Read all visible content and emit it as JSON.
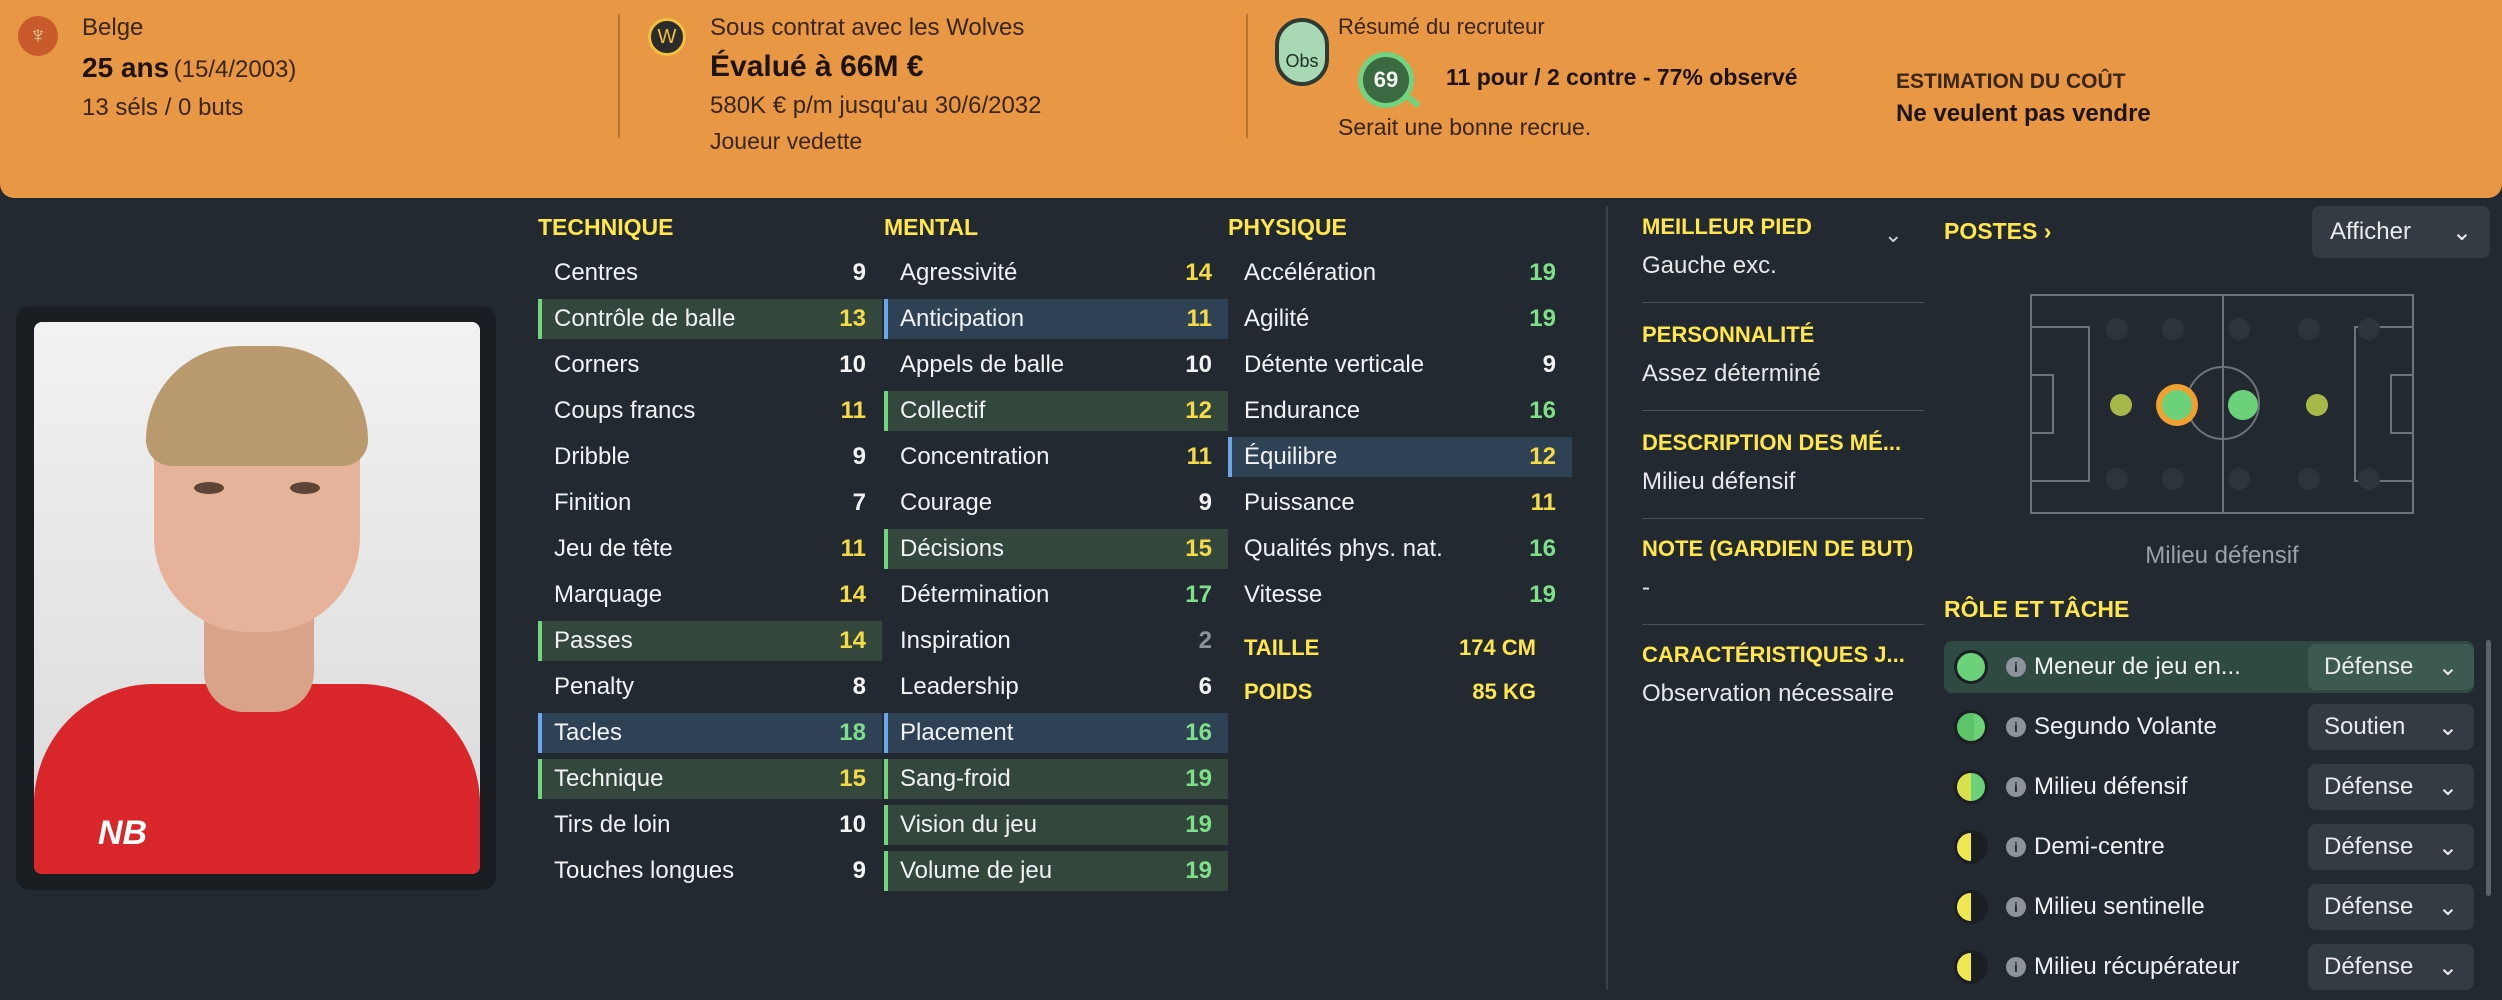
{
  "header": {
    "nationality": "Belge",
    "age": "25 ans",
    "dob": "(15/4/2003)",
    "caps": "13 séls / 0 buts",
    "contract": "Sous contrat avec les Wolves",
    "value": "Évalué à 66M €",
    "wage": "580K € p/m jusqu'au 30/6/2032",
    "squad_status": "Joueur vedette",
    "scout_summary_title": "Résumé du recruteur",
    "obs_label": "Obs",
    "rating": "69",
    "scout_votes": "11 pour / 2 contre - 77% observé",
    "scout_comment": "Serait une bonne recrue.",
    "cost_title": "ESTIMATION DU COÛT",
    "cost_value": "Ne veulent pas vendre"
  },
  "technique": {
    "title": "TECHNIQUE",
    "rows": [
      {
        "label": "Centres",
        "value": "9"
      },
      {
        "label": "Contrôle de balle",
        "value": "13"
      },
      {
        "label": "Corners",
        "value": "10"
      },
      {
        "label": "Coups francs",
        "value": "11"
      },
      {
        "label": "Dribble",
        "value": "9"
      },
      {
        "label": "Finition",
        "value": "7"
      },
      {
        "label": "Jeu de tête",
        "value": "11"
      },
      {
        "label": "Marquage",
        "value": "14"
      },
      {
        "label": "Passes",
        "value": "14"
      },
      {
        "label": "Penalty",
        "value": "8"
      },
      {
        "label": "Tacles",
        "value": "18"
      },
      {
        "label": "Technique",
        "value": "15"
      },
      {
        "label": "Tirs de loin",
        "value": "10"
      },
      {
        "label": "Touches longues",
        "value": "9"
      }
    ]
  },
  "mental": {
    "title": "MENTAL",
    "rows": [
      {
        "label": "Agressivité",
        "value": "14"
      },
      {
        "label": "Anticipation",
        "value": "11"
      },
      {
        "label": "Appels de balle",
        "value": "10"
      },
      {
        "label": "Collectif",
        "value": "12"
      },
      {
        "label": "Concentration",
        "value": "11"
      },
      {
        "label": "Courage",
        "value": "9"
      },
      {
        "label": "Décisions",
        "value": "15"
      },
      {
        "label": "Détermination",
        "value": "17"
      },
      {
        "label": "Inspiration",
        "value": "2"
      },
      {
        "label": "Leadership",
        "value": "6"
      },
      {
        "label": "Placement",
        "value": "16"
      },
      {
        "label": "Sang-froid",
        "value": "19"
      },
      {
        "label": "Vision du jeu",
        "value": "19"
      },
      {
        "label": "Volume de jeu",
        "value": "19"
      }
    ]
  },
  "physique": {
    "title": "PHYSIQUE",
    "rows": [
      {
        "label": "Accélération",
        "value": "19"
      },
      {
        "label": "Agilité",
        "value": "19"
      },
      {
        "label": "Détente verticale",
        "value": "9"
      },
      {
        "label": "Endurance",
        "value": "16"
      },
      {
        "label": "Équilibre",
        "value": "12"
      },
      {
        "label": "Puissance",
        "value": "11"
      },
      {
        "label": "Qualités phys. nat.",
        "value": "16"
      },
      {
        "label": "Vitesse",
        "value": "19"
      }
    ],
    "height_label": "TAILLE",
    "height_value": "174 CM",
    "weight_label": "POIDS",
    "weight_value": "85 KG"
  },
  "info": {
    "foot_title": "MEILLEUR PIED",
    "foot_value": "Gauche exc.",
    "personality_title": "PERSONNALITÉ",
    "personality_value": "Assez déterminé",
    "media_title": "DESCRIPTION DES MÉ...",
    "media_value": "Milieu défensif",
    "gk_title": "NOTE (GARDIEN DE BUT)",
    "gk_value": "-",
    "traits_title": "CARACTÉRISTIQUES J...",
    "traits_value": "Observation nécessaire"
  },
  "positions": {
    "title": "POSTES",
    "show_button": "Afficher",
    "caption": "Milieu défensif"
  },
  "roles": {
    "title": "RÔLE ET TÂCHE",
    "items": [
      {
        "name": "Meneur de jeu en...",
        "duty": "Défense"
      },
      {
        "name": "Segundo Volante",
        "duty": "Soutien"
      },
      {
        "name": "Milieu défensif",
        "duty": "Défense"
      },
      {
        "name": "Demi-centre",
        "duty": "Défense"
      },
      {
        "name": "Milieu sentinelle",
        "duty": "Défense"
      },
      {
        "name": "Milieu récupérateur",
        "duty": "Défense"
      }
    ]
  },
  "colors": {
    "header_bg": "#e89744",
    "attr_yellow": "#ffe64a",
    "value_green": "#7fe08a",
    "value_yellow": "#f5dc46"
  },
  "icons": {
    "nationality": "belgium-crest-icon",
    "club": "wolves-crest-icon",
    "dropdown": "chevron-down-icon",
    "info": "info-icon"
  }
}
